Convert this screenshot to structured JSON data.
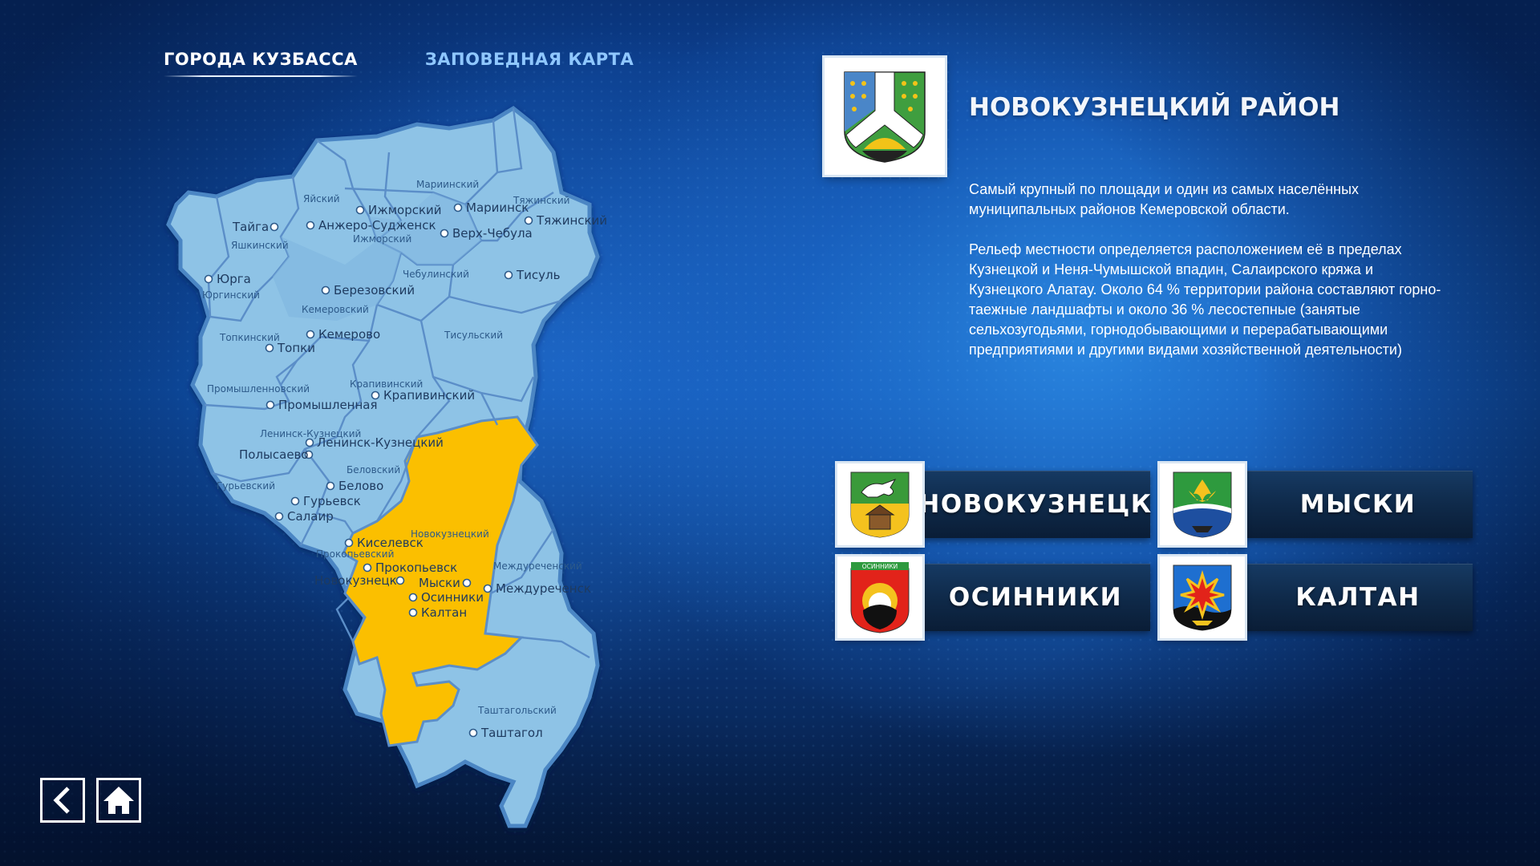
{
  "tabs": {
    "cities": "ГОРОДА КУЗБАССА",
    "reserve_map": "ЗАПОВЕДНАЯ КАРТА"
  },
  "district": {
    "title": "НОВОКУЗНЕЦКИЙ РАЙОН",
    "paragraph1": "Самый крупный по площади и один из самых населённых муниципальных районов Кемеровской области.",
    "paragraph2": "Рельеф местности определяется расположением её в пределах Кузнецкой и Неня-Чумышской впадин, Салаирского кряжа и Кузнецкого Алатау. Около 64 % территории района составляют горно-таежные ландшафты и около 36 % лесостепные (занятые сельхозугодьями, горнодобывающими и перерабатывающими предприятиями и другими видами хозяйственной деятельности)"
  },
  "cities": {
    "novokuznetsk": "НОВОКУЗНЕЦК",
    "myski": "МЫСКИ",
    "osinniki": "ОСИННИКИ",
    "kaltan": "КАЛТАН",
    "osinniki_crest_text": "ОСИННИКИ"
  },
  "map": {
    "districts": {
      "yaysky": "Яйский",
      "mariinsky": "Мариинский",
      "tyazhinsky": "Тяжинский",
      "yashkinsky": "Яшкинский",
      "izhmorsky": "Ижморский",
      "yurginsky": "Юргинский",
      "chebulinsky": "Чебулинский",
      "kemerovsky": "Кемеровский",
      "topkinsky": "Топкинский",
      "tisulsky": "Тисульский",
      "krapivinsky": "Крапивинский",
      "promyshlennovsky": "Промышленновский",
      "leninsk_kuznetsky": "Ленинск-Кузнецкий",
      "belovsky": "Беловский",
      "guryevsky": "Гурьевский",
      "novokuznetsky": "Новокузнецкий",
      "prokopyevsky": "Прокопьевский",
      "mezhdurechensky": "Междуреченский",
      "tashtagolsky": "Таштагольский"
    },
    "cities": {
      "tayga": "Тайга",
      "izhmorsky": "Ижморский",
      "mariinsk": "Мариинск",
      "tyazhinsky": "Тяжинский",
      "anzhero": "Анжеро-Судженск",
      "verkh_chebula": "Верх-Чебула",
      "yurga": "Юрга",
      "tisul": "Тисуль",
      "berezovsky": "Березовский",
      "kemerovo": "Кемерово",
      "topki": "Топки",
      "krapivinsky": "Крапивинский",
      "promyshlennaya": "Промышленная",
      "leninsk": "Ленинск-Кузнецкий",
      "polysaevo": "Полысаево",
      "belovo": "Белово",
      "guryevsk": "Гурьевск",
      "salair": "Салаир",
      "kiselevsk": "Киселевск",
      "prokopyevsk": "Прокопьевск",
      "novokuznetsk": "Новокузнецк",
      "myski": "Мыски",
      "osinniki": "Осинники",
      "kaltan": "Калтан",
      "mezhdurechensk": "Междуреченск",
      "tashtagol": "Таштагол"
    }
  },
  "colors": {
    "selected_district": "#fbbf00",
    "district_fill": "#8ec3e6",
    "district_fill_dark": "#6faad8",
    "border": "#3f78b6"
  },
  "nav": {
    "back_icon": "chevron-left-icon",
    "home_icon": "home-icon"
  }
}
